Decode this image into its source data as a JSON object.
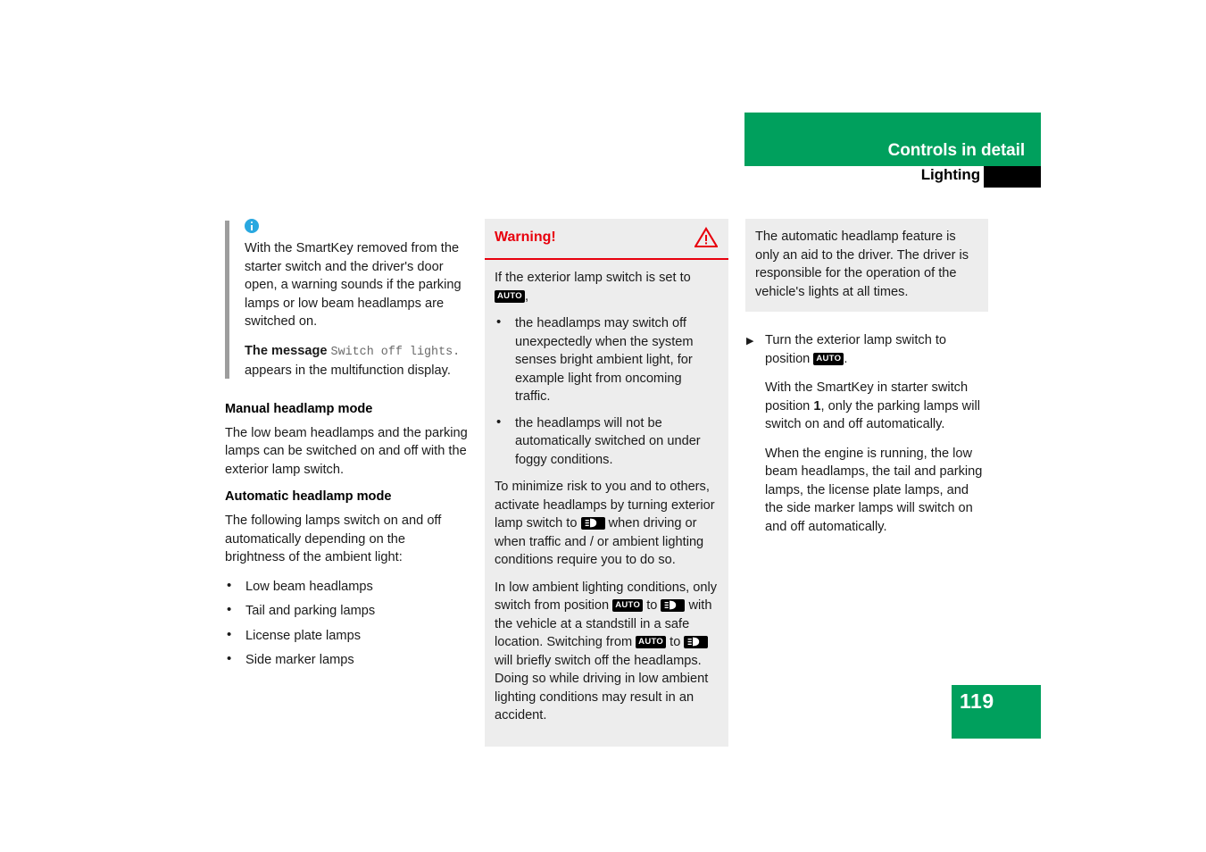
{
  "header": {
    "main_title": "Controls in detail",
    "sub_title": "Lighting",
    "green": "#00A05D",
    "tab_color": "#000000"
  },
  "page_number": "119",
  "badges": {
    "auto": "AUTO",
    "low_beam_icon": "low-beam-headlamp-icon"
  },
  "column1": {
    "info_note": {
      "icon": "info-icon",
      "paragraph1": "With the SmartKey removed from the starter switch and the driver's door open, a warning sounds if the parking lamps or low beam headlamps are switched on.",
      "paragraph2_prefix": "The message ",
      "paragraph2_mono": "Switch off lights.",
      "paragraph2_suffix": " appears in the multifunction display."
    },
    "manual_heading": "Manual headlamp mode",
    "manual_text": "The low beam headlamps and the parking lamps can be switched on and off with the exterior lamp switch.",
    "automatic_heading": "Automatic headlamp mode",
    "automatic_text": "The following lamps switch on and off automatically depending on the brightness of the ambient light:",
    "lamp_list": [
      "Low beam headlamps",
      "Tail and parking lamps",
      "License plate lamps",
      "Side marker lamps"
    ]
  },
  "column2": {
    "warning_title": "Warning!",
    "warning_icon": "warning-triangle-icon",
    "warning_color": "#E8000D",
    "intro_prefix": "If the exterior lamp switch is set to ",
    "intro_suffix": ",",
    "bullets": [
      "the headlamps may switch off unexpectedly when the system senses bright ambient light, for example light from oncoming traffic.",
      "the headlamps will not be automatically switched on under foggy conditions."
    ],
    "para2_part1": "To minimize risk to you and to others, activate headlamps by turning exterior lamp switch to ",
    "para2_part2": " when driving or when traffic and / or ambient lighting conditions require you to do so.",
    "para3_part1": "In low ambient lighting conditions, only switch from position ",
    "para3_part2": " to ",
    "para3_part3": " with the vehicle at a standstill in a safe location. Switching from ",
    "para3_part4": " to ",
    "para3_part5": " will briefly switch off the headlamps. Doing so while driving in low ambient lighting conditions may result in an accident."
  },
  "column3": {
    "note_text": "The automatic headlamp feature is only an aid to the driver. The driver is responsible for the operation of the vehicle's lights at all times.",
    "instruction_prefix": "Turn the exterior lamp switch to position ",
    "instruction_suffix": ".",
    "sub_para1_part1": "With the SmartKey in starter switch position ",
    "sub_para1_bold": "1",
    "sub_para1_part2": ", only the parking lamps will switch on and off automatically.",
    "sub_para2": "When the engine is running, the low beam headlamps, the tail and parking lamps, the license plate lamps, and the side marker lamps will switch on and off automatically."
  }
}
